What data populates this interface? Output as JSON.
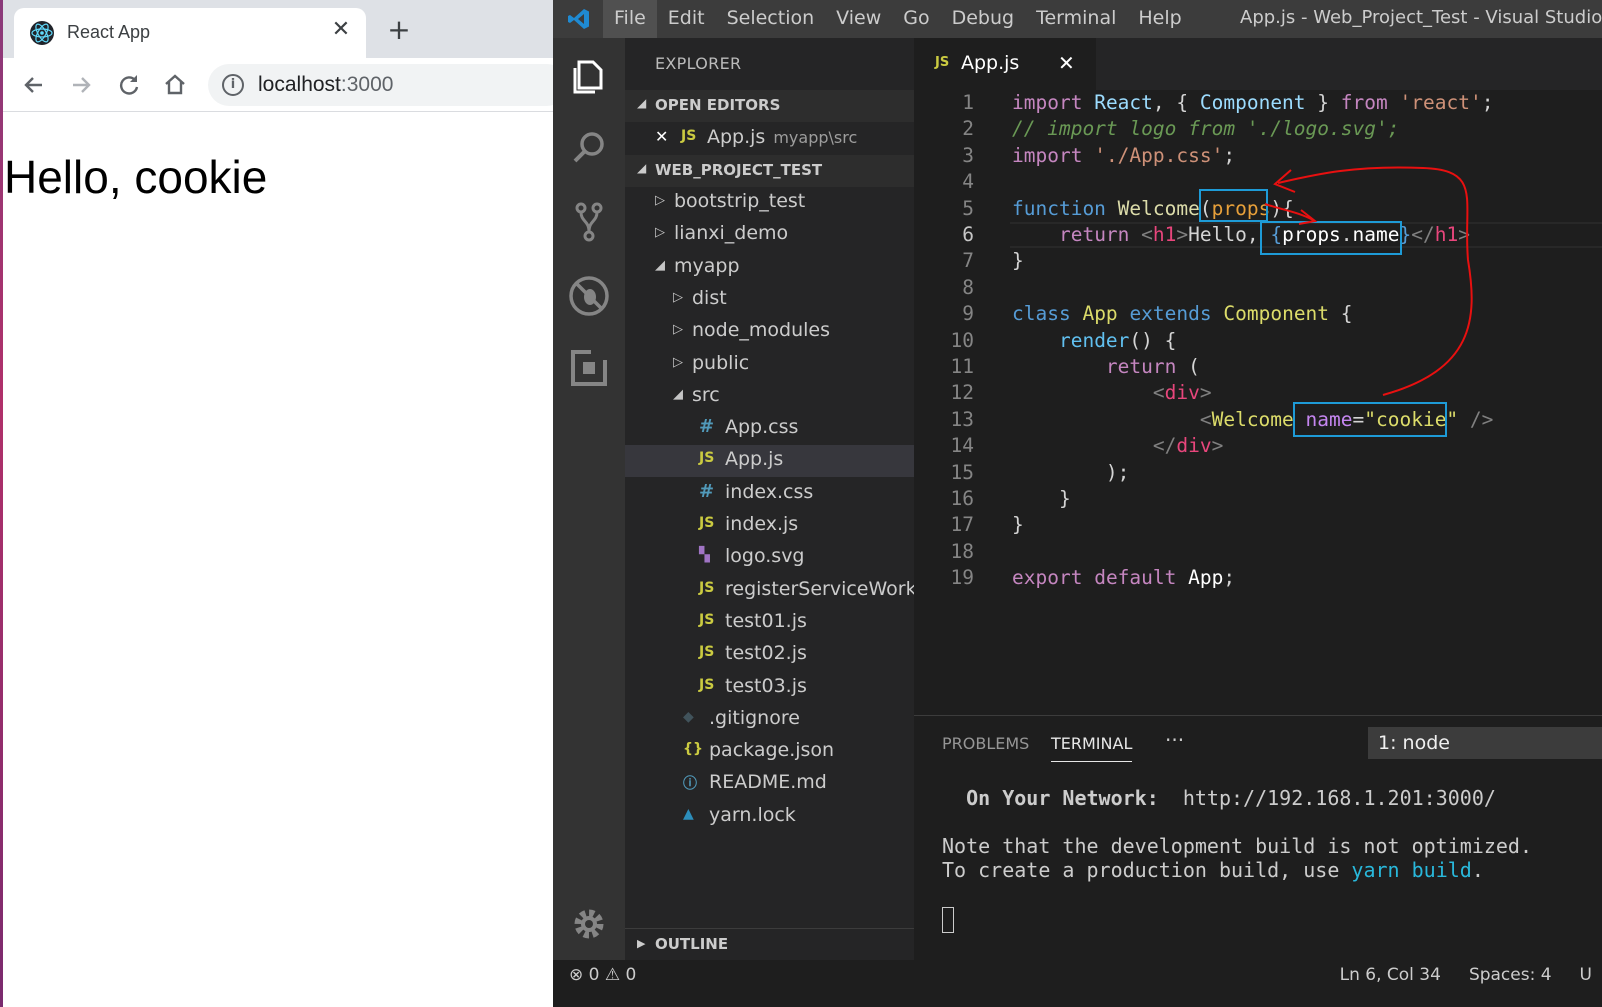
{
  "browser": {
    "tab_title": "React App",
    "tab_close": "✕",
    "new_tab": "+",
    "url_host": "localhost",
    "url_port": ":3000",
    "page_heading": "Hello, cookie"
  },
  "vscode": {
    "menu": [
      "File",
      "Edit",
      "Selection",
      "View",
      "Go",
      "Debug",
      "Terminal",
      "Help"
    ],
    "window_title": "App.js - Web_Project_Test - Visual Studio C",
    "explorer_title": "EXPLORER",
    "open_editors_label": "OPEN EDITORS",
    "open_editor": {
      "name": "App.js",
      "path": "myapp\\src"
    },
    "workspace_label": "WEB_PROJECT_TEST",
    "outline_label": "OUTLINE",
    "tree": [
      {
        "name": "bootstrip_test",
        "kind": "folder",
        "open": false
      },
      {
        "name": "lianxi_demo",
        "kind": "folder",
        "open": false
      },
      {
        "name": "myapp",
        "kind": "folder",
        "open": true
      },
      {
        "name": "dist",
        "kind": "folder",
        "open": false
      },
      {
        "name": "node_modules",
        "kind": "folder",
        "open": false
      },
      {
        "name": "public",
        "kind": "folder",
        "open": false
      },
      {
        "name": "src",
        "kind": "folder",
        "open": true
      },
      {
        "name": "App.css",
        "kind": "css"
      },
      {
        "name": "App.js",
        "kind": "js",
        "selected": true
      },
      {
        "name": "index.css",
        "kind": "css"
      },
      {
        "name": "index.js",
        "kind": "js"
      },
      {
        "name": "logo.svg",
        "kind": "svg"
      },
      {
        "name": "registerServiceWorker.js",
        "kind": "js"
      },
      {
        "name": "test01.js",
        "kind": "js"
      },
      {
        "name": "test02.js",
        "kind": "js"
      },
      {
        "name": "test03.js",
        "kind": "js"
      },
      {
        "name": ".gitignore",
        "kind": "git"
      },
      {
        "name": "package.json",
        "kind": "json"
      },
      {
        "name": "README.md",
        "kind": "md"
      },
      {
        "name": "yarn.lock",
        "kind": "yarn"
      }
    ],
    "editor_tab": "App.js",
    "line_numbers": [
      "1",
      "2",
      "3",
      "4",
      "5",
      "6",
      "7",
      "8",
      "9",
      "10",
      "11",
      "12",
      "13",
      "14",
      "15",
      "16",
      "17",
      "18",
      "19"
    ],
    "current_line": "6",
    "panel": {
      "tabs": [
        "PROBLEMS",
        "TERMINAL"
      ],
      "more": "···",
      "terminal_select": "1: node",
      "network_label": "On Your Network:",
      "network_url": "http://192.168.1.201:3000/",
      "note1": "Note that the development build is not optimized.",
      "note2_pre": "To create a production build, use ",
      "note2_cmd": "yarn build",
      "note2_post": "."
    },
    "status": {
      "errors": "0",
      "warnings": "0",
      "position": "Ln 6, Col 34",
      "spaces": "Spaces: 4",
      "extra": "U"
    },
    "colors": {
      "keyword": "#c586c0",
      "function": "#dcdcaa",
      "type": "#4ec9b0",
      "string": "#ce9178",
      "annotation": "#e81010",
      "highlight_box": "#1e9bd7"
    }
  }
}
